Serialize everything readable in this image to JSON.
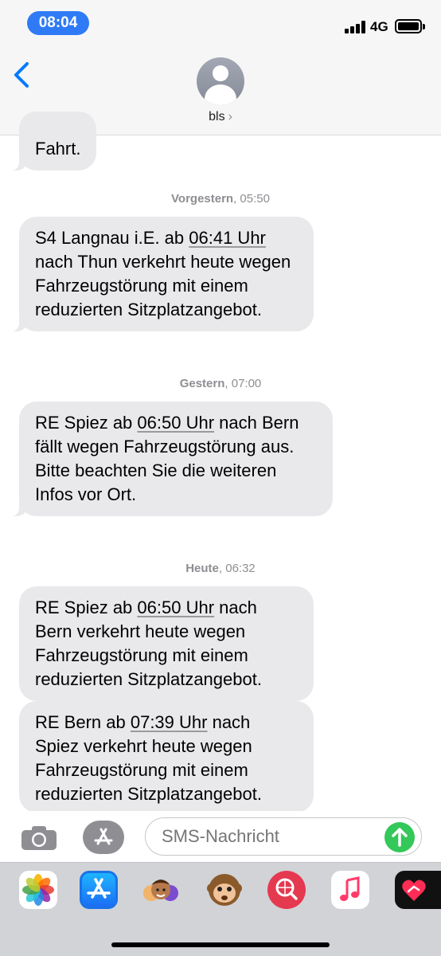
{
  "status_bar": {
    "time": "08:04",
    "network": "4G"
  },
  "header": {
    "contact_name": "bls",
    "chevron": "›"
  },
  "messages": [
    {
      "text_parts": [
        "Fahrt."
      ]
    },
    {
      "text_parts": [
        "S4 Langnau i.E. ab ",
        "06:41 Uhr",
        " nach Thun verkehrt heute wegen Fahrzeugstörung mit einem reduzierten Sitzplatzangebot."
      ]
    },
    {
      "text_parts": [
        "RE Spiez ab ",
        "06:50 Uhr",
        " nach Bern fällt wegen Fahrzeugstörung aus. Bitte beachten Sie die weiteren Infos vor Ort."
      ]
    },
    {
      "text_parts": [
        "RE Spiez ab ",
        "06:50 Uhr",
        " nach Bern verkehrt heute wegen Fahrzeugstörung mit einem reduzierten Sitzplatzangebot."
      ]
    },
    {
      "text_parts": [
        "RE Bern ab ",
        "07:39 Uhr",
        " nach Spiez verkehrt heute wegen Fahrzeugstörung mit einem reduzierten Sitzplatzangebot."
      ]
    }
  ],
  "timestamps": [
    {
      "day": "Vorgestern",
      "time": ", 05:50"
    },
    {
      "day": "Gestern",
      "time": ", 07:00"
    },
    {
      "day": "Heute",
      "time": ", 06:32"
    }
  ],
  "input": {
    "placeholder": "SMS-Nachricht"
  },
  "icons": {
    "camera": "camera-icon",
    "appstore": "appstore-icon",
    "send": "arrow-up-icon"
  },
  "drawer_apps": [
    "photos-icon",
    "appstore-icon",
    "memoji-icon",
    "animoji-icon",
    "search-images-icon",
    "music-icon",
    "digital-touch-icon"
  ],
  "colors": {
    "accent": "#007aff",
    "bubble": "#e9e9eb",
    "send": "#34c759",
    "time_pill": "#2f7bf5"
  }
}
